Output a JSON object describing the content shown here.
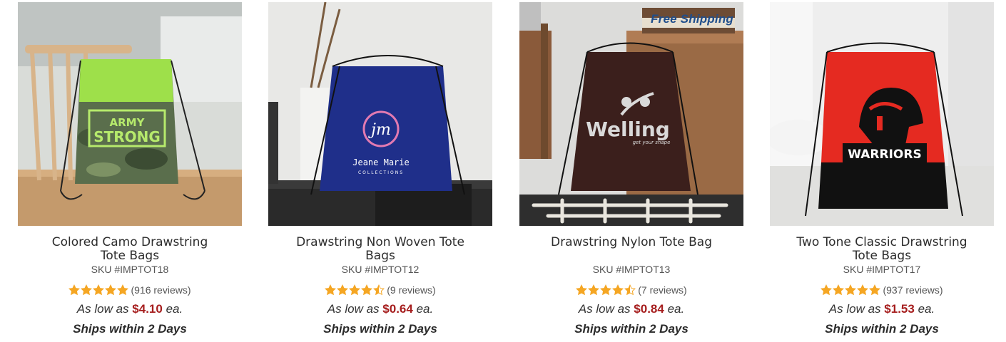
{
  "colors": {
    "price": "#a61e1e",
    "star": "#f5a623",
    "ribbon": "#1f4e8c"
  },
  "products": [
    {
      "title": "Colored Camo Drawstring Tote Bags",
      "sku": "SKU #IMPTOT18",
      "rating": 5,
      "reviews": "(916 reviews)",
      "price_prefix": "As low as",
      "price": "$4.10",
      "price_suffix": "ea.",
      "ships": "Ships within 2 Days",
      "image_text": "ARMY STRONG"
    },
    {
      "title": "Drawstring Non Woven Tote Bags",
      "sku": "SKU #IMPTOT12",
      "rating": 4.5,
      "reviews": "(9 reviews)",
      "price_prefix": "As low as",
      "price": "$0.64",
      "price_suffix": "ea.",
      "ships": "Ships within 2 Days",
      "image_text": "Jeane Marie",
      "image_subtext": "COLLECTIONS"
    },
    {
      "title": "Drawstring Nylon Tote Bag",
      "sku": "SKU #IMPTOT13",
      "rating": 4.5,
      "reviews": "(7 reviews)",
      "price_prefix": "As low as",
      "price": "$0.84",
      "price_suffix": "ea.",
      "ships": "Ships within 2 Days",
      "ribbon": "Free Shipping",
      "image_text": "Welling",
      "image_subtext": "get your shape"
    },
    {
      "title": "Two Tone Classic Drawstring Tote Bags",
      "sku": "SKU #IMPTOT17",
      "rating": 5,
      "reviews": "(937 reviews)",
      "price_prefix": "As low as",
      "price": "$1.53",
      "price_suffix": "ea.",
      "ships": "Ships within 2 Days",
      "image_text": "WARRIORS"
    }
  ]
}
